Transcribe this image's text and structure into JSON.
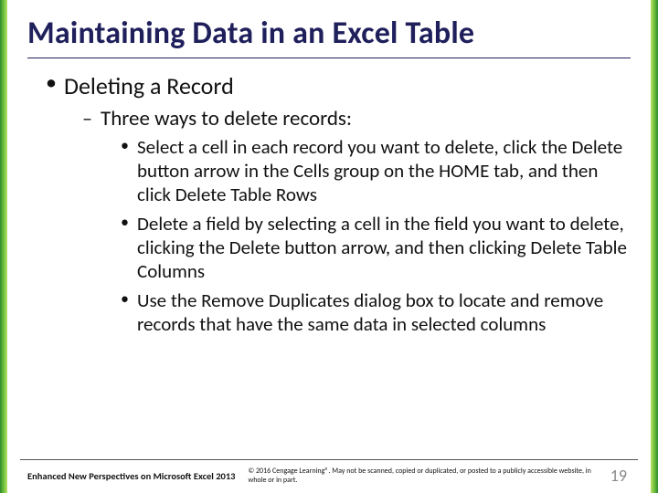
{
  "title": "Maintaining Data in an Excel Table",
  "bullets": {
    "lvl1": "Deleting a Record",
    "lvl2": "Three ways to delete records:",
    "lvl3": [
      "Select a cell in each record you want to delete, click the Delete button arrow in the Cells group on the HOME tab, and then click Delete Table Rows",
      "Delete a field by selecting a cell in the field you want to delete, clicking the Delete button arrow, and then clicking Delete Table Columns",
      "Use the Remove Duplicates dialog box to locate and remove records that have the same data in selected columns"
    ]
  },
  "footer": {
    "left": "Enhanced New Perspectives on Microsoft Excel 2013",
    "mid": "© 2016 Cengage Learning®. May not be scanned, copied or duplicated, or posted to a publicly accessible website, in whole or in part.",
    "page": "19"
  }
}
